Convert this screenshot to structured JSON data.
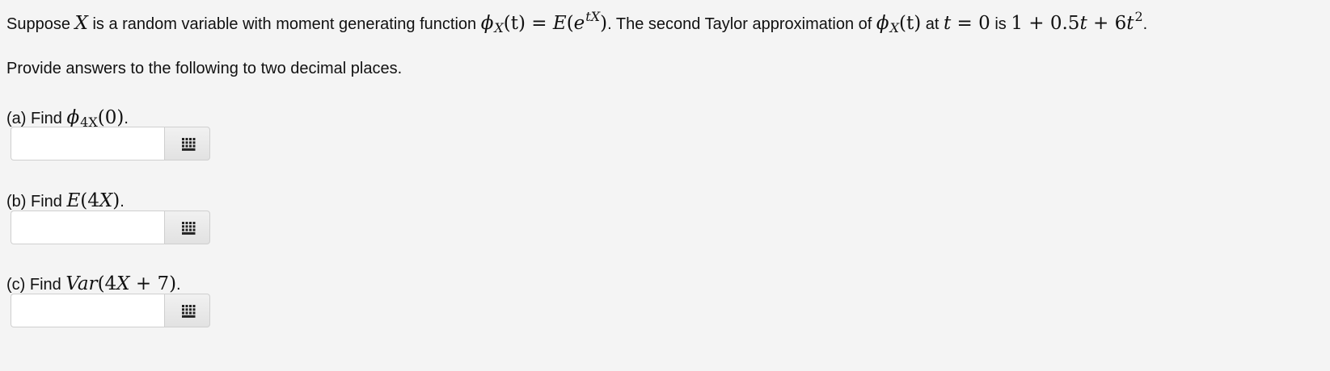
{
  "question": {
    "intro": {
      "t1": "Suppose ",
      "var_X": "X",
      "t2": " is a random variable with moment generating function ",
      "phi": "ϕ",
      "sub_X": "X",
      "paren_t": "(t)",
      "eq": " = ",
      "E": "E",
      "paren_open": "(",
      "e": "e",
      "sup_tX": "tX",
      "paren_close": ")",
      "t3": ". The second Taylor approximation of ",
      "phi2": "ϕ",
      "sub_X2": "X",
      "paren_t2": "(t)",
      "t4": " at ",
      "t_var": "t",
      "eq2": " = 0",
      "t5": " is ",
      "poly": "1 + 0.5",
      "poly_t": "t",
      "poly_plus": " + 6",
      "poly_t2": "t",
      "sup_2": "2",
      "end": "."
    },
    "instruction": "Provide answers to the following to two decimal places."
  },
  "parts": [
    {
      "prefix": "(a) Find ",
      "math_a1": "ϕ",
      "math_a_sub": "4X",
      "math_a2": "(0)",
      "suffix": ".",
      "value": ""
    },
    {
      "prefix": "(b) Find ",
      "math_b1": "E",
      "math_b2": "(4",
      "math_b3": "X",
      "math_b4": ")",
      "suffix": ".",
      "value": ""
    },
    {
      "prefix": "(c) Find ",
      "math_c1": "Var",
      "math_c2": "(4",
      "math_c3": "X",
      "math_c4": " + 7)",
      "suffix": ".",
      "value": ""
    }
  ],
  "icons": {
    "keyboard": "grid-icon"
  }
}
